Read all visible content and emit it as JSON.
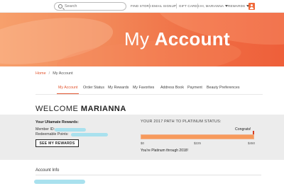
{
  "header": {
    "search_placeholder": "Search",
    "nav": {
      "find_store": "FIND STORE",
      "email_signup": "EMAIL SIGNUP",
      "gift_cards": "GIFT CARDS",
      "user_menu": "HI, MARIANNA",
      "rewards_menu": "REWARDS"
    },
    "icons": {
      "search": "search-icon",
      "user": "user-icon",
      "dropdown": "chevron-down-icon"
    }
  },
  "banner": {
    "title_light": "My",
    "title_bold": "Account"
  },
  "breadcrumb": {
    "home": "Home",
    "separator": "/",
    "current": "My Account"
  },
  "tabs": [
    {
      "label": "My Account",
      "active": true
    },
    {
      "label": "Order Status",
      "active": false
    },
    {
      "label": "My Rewards",
      "active": false
    },
    {
      "label": "My Favorites",
      "active": false
    },
    {
      "label": "Address Book",
      "active": false
    },
    {
      "label": "Payment",
      "active": false
    },
    {
      "label": "Beauty Preferences",
      "active": false
    }
  ],
  "welcome": {
    "prefix": "WELCOME",
    "name": "MARIANNA"
  },
  "rewards": {
    "title": "Your Ultamate Rewards:",
    "member_id_label": "Member ID:",
    "points_label": "Redeemable Points:",
    "button_label": "SEE MY REWARDS"
  },
  "status_path": {
    "title": "YOUR 2017 PATH TO PLATINUM STATUS:",
    "congrats": "Congrats!",
    "ticks": [
      "$0",
      "$225",
      "$450"
    ],
    "progress_fraction": 1.0,
    "message": "You're Platinum through 2018!"
  },
  "account_info": {
    "title": "Account Info"
  },
  "colors": {
    "accent": "#e2552f",
    "banner_start": "#f7a06c",
    "banner_end": "#ee5f3a",
    "progress_fill": "#f79a5c",
    "redaction": "#a9e1ee",
    "panel_gray": "#ececec"
  }
}
